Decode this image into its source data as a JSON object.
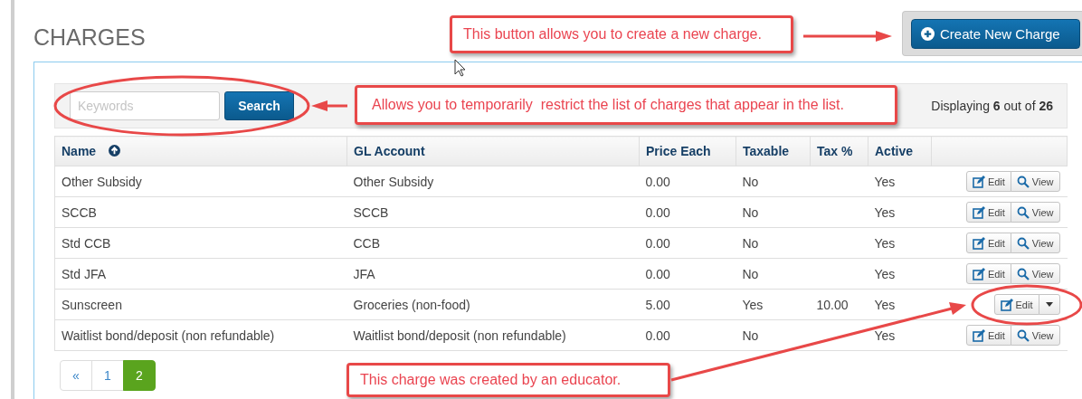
{
  "page": {
    "title": "CHARGES"
  },
  "create_button": {
    "label": "Create New Charge"
  },
  "search": {
    "placeholder": "Keywords",
    "button": "Search"
  },
  "summary": "Displaying **6** out of **26**",
  "table": {
    "columns": [
      {
        "label": "Name",
        "sorted": true
      },
      {
        "label": "GL Account",
        "sorted": false
      },
      {
        "label": "Price Each",
        "sorted": false
      },
      {
        "label": "Taxable",
        "sorted": false
      },
      {
        "label": "Tax %",
        "sorted": false
      },
      {
        "label": "Active",
        "sorted": false
      }
    ],
    "rows": [
      {
        "name": "Other Subsidy",
        "gl_account": "Other Subsidy",
        "price": "0.00",
        "taxable": "No",
        "tax_pct": "",
        "active": "Yes",
        "actions": {
          "kind": "edit_view",
          "edit": "Edit",
          "view": "View"
        }
      },
      {
        "name": "SCCB",
        "gl_account": "SCCB",
        "price": "0.00",
        "taxable": "No",
        "tax_pct": "",
        "active": "Yes",
        "actions": {
          "kind": "edit_view",
          "edit": "Edit",
          "view": "View"
        }
      },
      {
        "name": "Std CCB",
        "gl_account": "CCB",
        "price": "0.00",
        "taxable": "No",
        "tax_pct": "",
        "active": "Yes",
        "actions": {
          "kind": "edit_view",
          "edit": "Edit",
          "view": "View"
        }
      },
      {
        "name": "Std JFA",
        "gl_account": "JFA",
        "price": "0.00",
        "taxable": "No",
        "tax_pct": "",
        "active": "Yes",
        "actions": {
          "kind": "edit_view",
          "edit": "Edit",
          "view": "View"
        }
      },
      {
        "name": "Sunscreen",
        "gl_account": "Groceries (non-food)",
        "price": "5.00",
        "taxable": "Yes",
        "tax_pct": "10.00",
        "active": "Yes",
        "actions": {
          "kind": "edit_menu",
          "edit": "Edit"
        }
      },
      {
        "name": "Waitlist bond/deposit (non refundable)",
        "gl_account": "Waitlist bond/deposit (non refundable)",
        "price": "0.00",
        "taxable": "No",
        "tax_pct": "",
        "active": "Yes",
        "actions": {
          "kind": "edit_view",
          "edit": "Edit",
          "view": "View"
        }
      }
    ]
  },
  "pagination": [
    {
      "label": "«",
      "selected": false
    },
    {
      "label": "1",
      "selected": false
    },
    {
      "label": "2",
      "selected": true
    }
  ],
  "annotations": [
    {
      "kind": "callout",
      "text": "This button allows you to create a new charge."
    },
    {
      "kind": "callout",
      "text": "Allows you to temporarily  restrict the list of charges that appear in the list."
    },
    {
      "kind": "callout",
      "text": "This charge was created by an educator."
    }
  ]
}
